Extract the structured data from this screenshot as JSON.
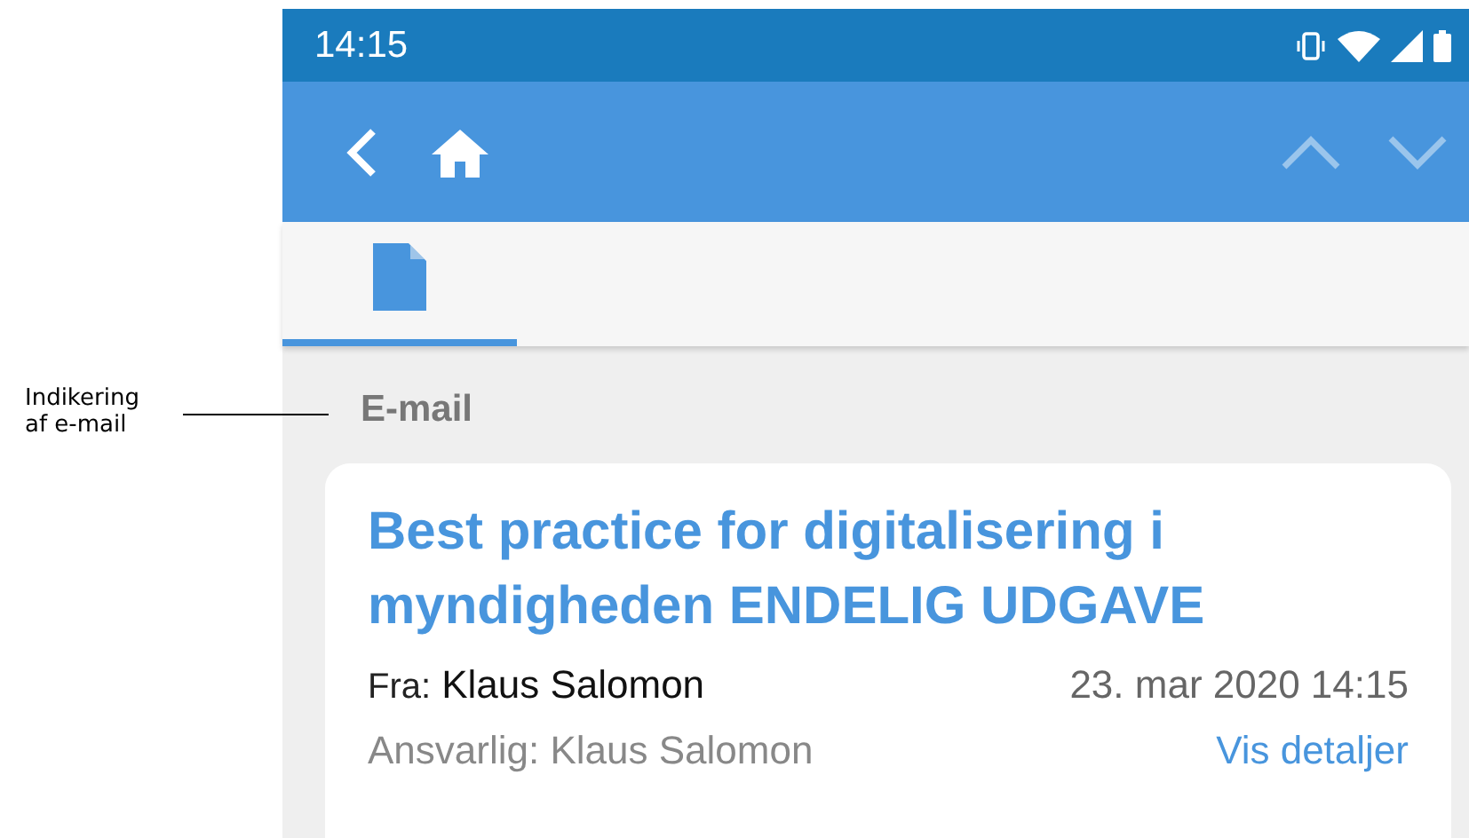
{
  "annotation": {
    "text": "Indikering\naf e-mail"
  },
  "status_bar": {
    "time": "14:15"
  },
  "toolbar": {
    "buttons": [
      {
        "kind": "back",
        "disabled": false
      },
      {
        "kind": "home",
        "disabled": false
      },
      {
        "kind": "up",
        "disabled": true
      },
      {
        "kind": "down",
        "disabled": true
      }
    ]
  },
  "tabs": [
    {
      "kind": "document",
      "selected": true
    }
  ],
  "section_label": "E-mail",
  "card": {
    "title": "Best practice for digitalisering i myndigheden ENDELIG UDGAVE",
    "from_label": "Fra:",
    "from": "Klaus Salomon",
    "date": "23. mar 2020 14:15",
    "responsible": "Ansvarlig: Klaus Salomon",
    "details_link": "Vis detaljer"
  }
}
